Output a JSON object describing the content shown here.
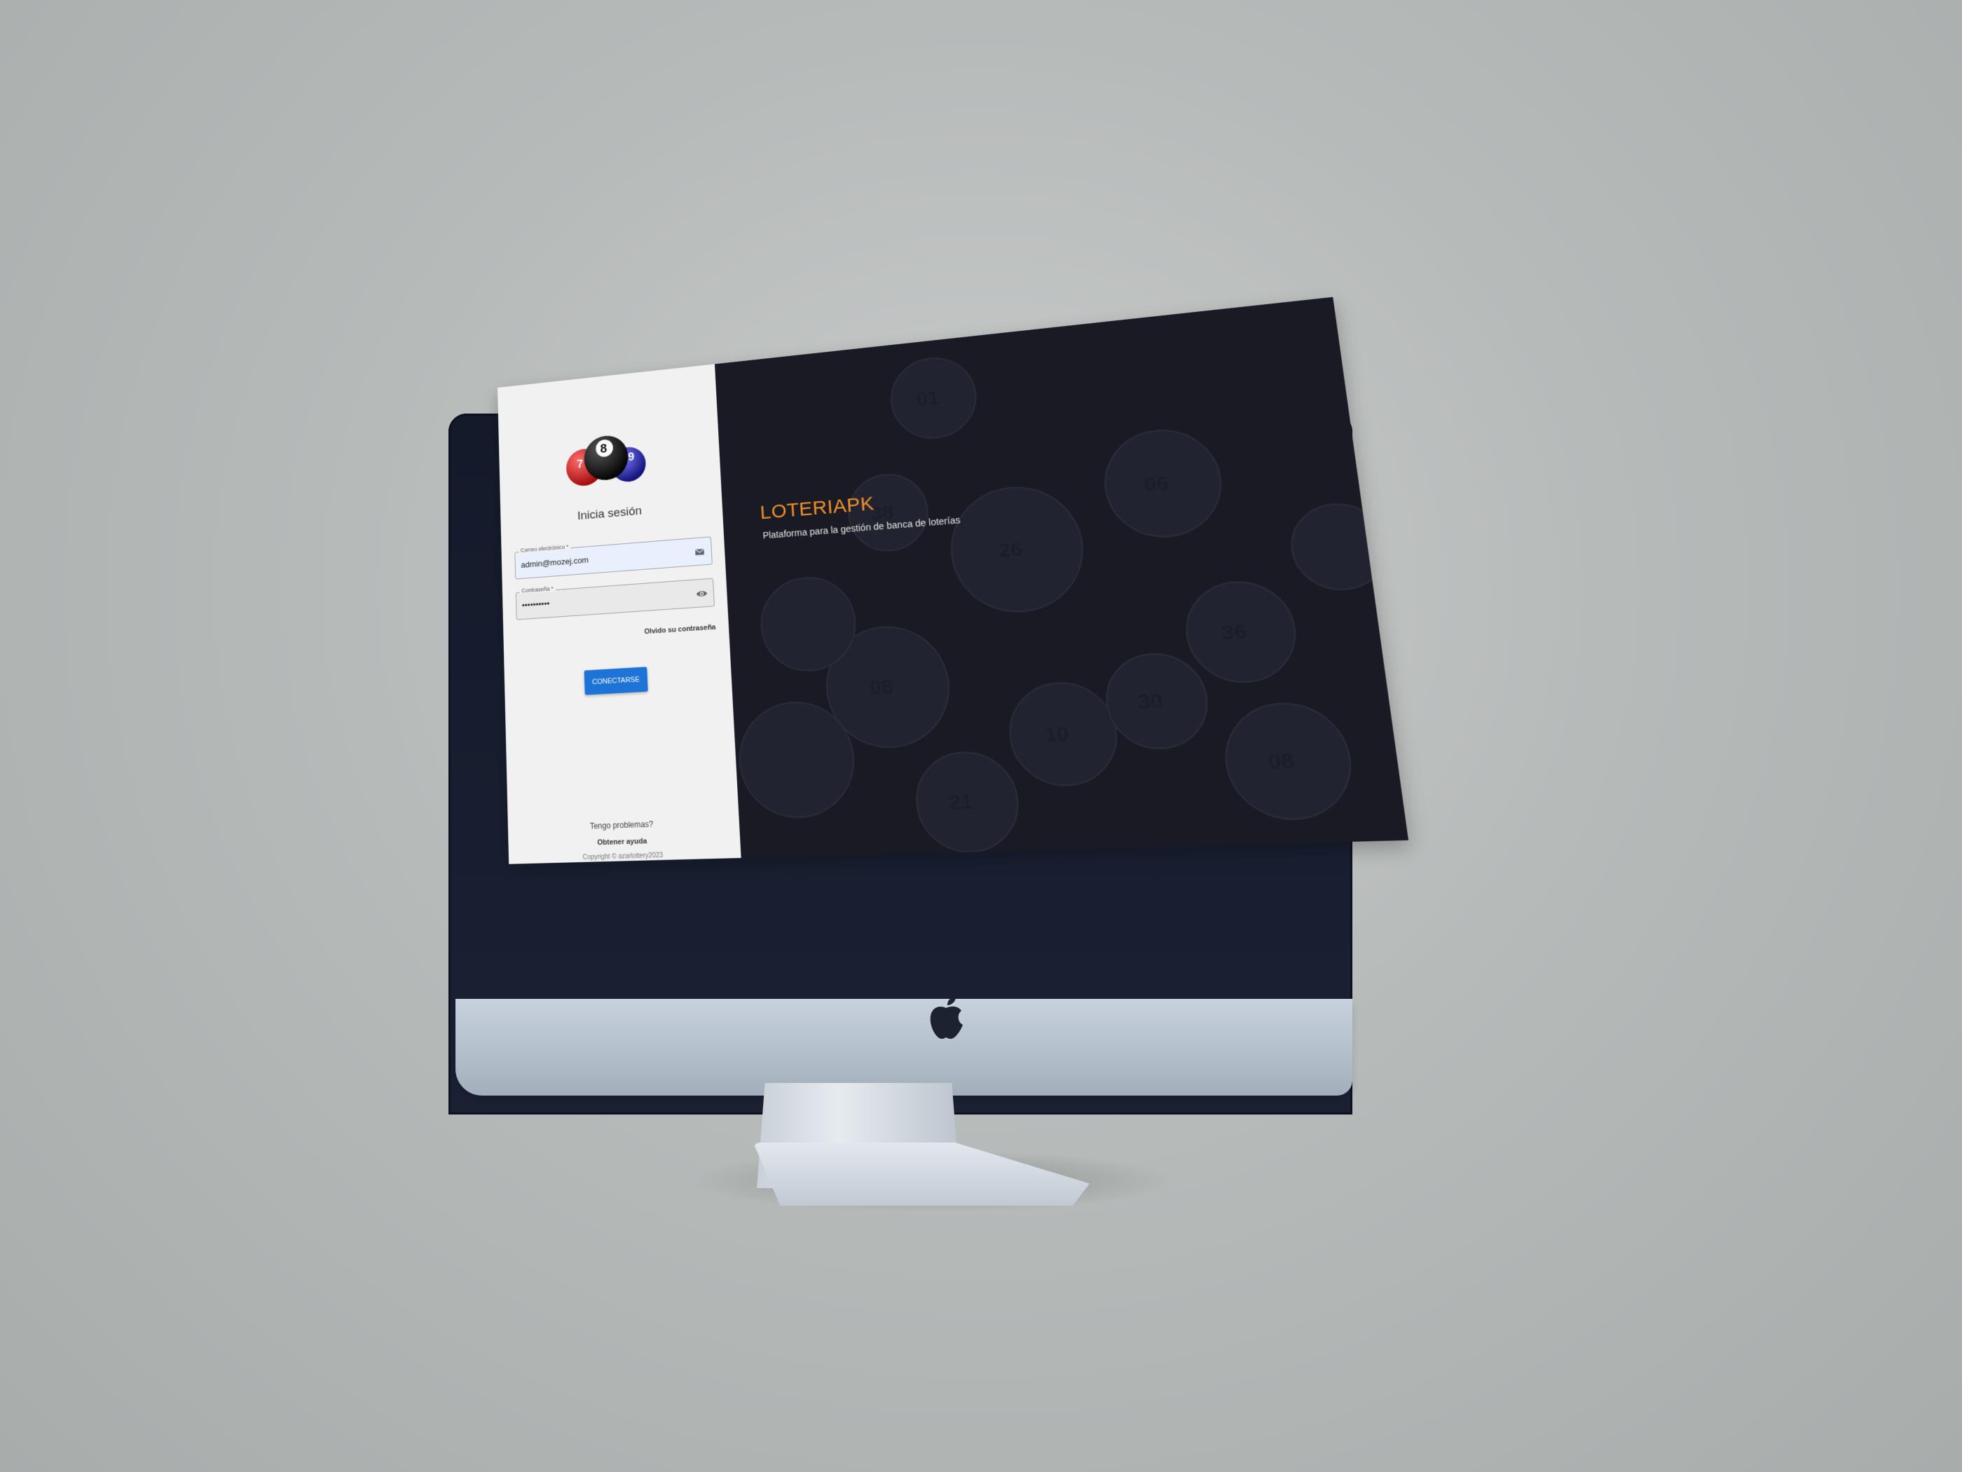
{
  "login": {
    "title": "Inicia sesión",
    "email": {
      "label": "Correo electrónico *",
      "value": "admin@mozej.com",
      "icon": "mail-icon"
    },
    "password": {
      "label": "Contraseña *",
      "value": "••••••••••",
      "icon": "eye-icon"
    },
    "forgot_label": "Olvido su contraseña",
    "submit_label": "CONECTARSE",
    "problems_label": "Tengo problemas?",
    "help_label": "Obtener ayuda",
    "copyright": "Copyright © azarlottery2023"
  },
  "hero": {
    "title": "LOTERIAPK",
    "subtitle": "Plataforma para la gestión de banca de loterías"
  },
  "colors": {
    "accent": "#f0922b",
    "button": "#1e73d6",
    "hero_bg": "#1a1a24",
    "panel_bg": "#f1f1f1"
  }
}
